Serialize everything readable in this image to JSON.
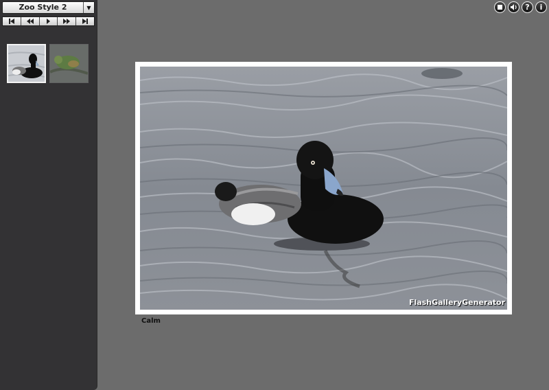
{
  "album": {
    "title": "Zoo Style 2",
    "dropdown_icon": "chevron-down-icon"
  },
  "controls": {
    "buttons": [
      {
        "name": "first",
        "icon": "skip-first-icon"
      },
      {
        "name": "previous",
        "icon": "rewind-icon"
      },
      {
        "name": "play",
        "icon": "play-icon"
      },
      {
        "name": "next",
        "icon": "fast-forward-icon"
      },
      {
        "name": "last",
        "icon": "skip-last-icon"
      }
    ]
  },
  "thumbnails": [
    {
      "subject": "duck",
      "selected": true
    },
    {
      "subject": "parrot",
      "selected": false
    }
  ],
  "top_buttons": [
    {
      "name": "stop",
      "icon": "stop-icon"
    },
    {
      "name": "sound",
      "icon": "speaker-icon"
    },
    {
      "name": "help",
      "icon": "help-icon",
      "glyph": "?"
    },
    {
      "name": "info",
      "icon": "info-icon",
      "glyph": "i"
    }
  ],
  "photo": {
    "watermark": "FlashGalleryGenerator",
    "caption": "Calm"
  },
  "colors": {
    "sidebar": "#333234",
    "stage": "#6c6c6c",
    "frame": "#ffffff"
  }
}
